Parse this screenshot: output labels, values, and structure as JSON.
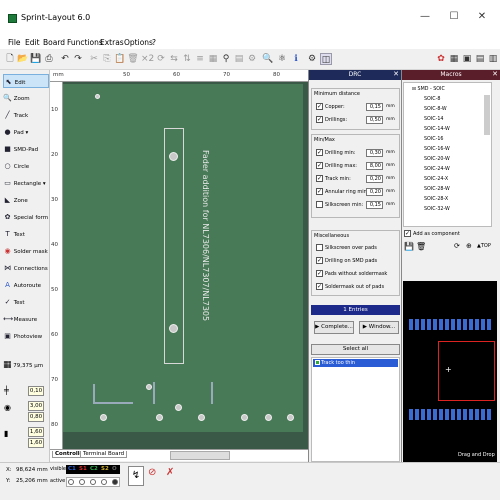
{
  "window": {
    "title": "Sprint-Layout 6.0",
    "minimize": "—",
    "maximize": "☐",
    "close": "✕"
  },
  "menu": [
    "File",
    "Edit",
    "Board",
    "Functions",
    "Extras",
    "Options",
    "?"
  ],
  "tools": [
    {
      "label": "Edit",
      "icon": "⬉"
    },
    {
      "label": "Zoom",
      "icon": "🔍"
    },
    {
      "label": "Track",
      "icon": "╱"
    },
    {
      "label": "Pad",
      "icon": "●"
    },
    {
      "label": "SMD-Pad",
      "icon": "■"
    },
    {
      "label": "Circle",
      "icon": "○"
    },
    {
      "label": "Rectangle",
      "icon": "▭"
    },
    {
      "label": "Zone",
      "icon": "◣"
    },
    {
      "label": "Special form",
      "icon": "✿"
    },
    {
      "label": "Text",
      "icon": "T"
    },
    {
      "label": "Solder mask",
      "icon": "◉"
    },
    {
      "label": "Connections",
      "icon": "⋈"
    },
    {
      "label": "Autoroute",
      "icon": "A"
    },
    {
      "label": "Test",
      "icon": "✓"
    },
    {
      "label": "Measure",
      "icon": "⟷"
    },
    {
      "label": "Photoview",
      "icon": "▣"
    }
  ],
  "grid": {
    "value": "79,375 µm"
  },
  "spinners": [
    "0,10",
    "3,00",
    "0,80",
    "1,60",
    "1,60"
  ],
  "ruler": {
    "unit": "mm",
    "ticks": [
      "50",
      "60",
      "70",
      "80"
    ],
    "left_ticks": [
      "10",
      "20",
      "30",
      "40",
      "50",
      "60",
      "70",
      "80"
    ]
  },
  "board": {
    "silkscreen_text": "Fader addition for NL7306/NL7307/NL7305"
  },
  "tabs": [
    "Controller",
    "Terminal Board"
  ],
  "status": {
    "x_label": "X:",
    "x_value": "98,624 mm",
    "y_label": "Y:",
    "y_value": "25,206 mm",
    "visible_label": "visible",
    "active_label": "active",
    "layers": [
      "C1",
      "S1",
      "C2",
      "S2",
      "O"
    ],
    "layer_colors": [
      "#2d5fd1",
      "#d92b2b",
      "#2fa84a",
      "#d1b22d",
      "#666666"
    ]
  },
  "drc": {
    "title": "DRC",
    "min_distance": {
      "title": "Minimum distance",
      "copper_label": "Copper:",
      "copper_value": "0,15",
      "drillings_label": "Drillings:",
      "drillings_value": "0,50",
      "unit": "mm"
    },
    "minmax": {
      "title": "Min/Max",
      "rows": [
        {
          "label": "Drilling min:",
          "value": "0,30",
          "checked": true
        },
        {
          "label": "Drilling max:",
          "value": "8,00",
          "checked": true
        },
        {
          "label": "Track min:",
          "value": "0,20",
          "checked": true
        },
        {
          "label": "Annular ring min:",
          "value": "0,20",
          "checked": true
        },
        {
          "label": "Silkscreen min:",
          "value": "0,15",
          "checked": false
        }
      ]
    },
    "misc": {
      "title": "Miscellaneous",
      "rows": [
        {
          "label": "Silkscreen over pads",
          "checked": false
        },
        {
          "label": "Drilling on SMD pads",
          "checked": true
        },
        {
          "label": "Pads without soldermask",
          "checked": true
        },
        {
          "label": "Soldermask out of pads",
          "checked": true
        }
      ]
    },
    "entries": "1 Entries",
    "complete_button": "Complete...",
    "window_button": "Window...",
    "select_all": "Select all",
    "result": "Track too thin"
  },
  "macros": {
    "title": "Macros",
    "root": "SMD - SOIC",
    "items": [
      "SOIC-8",
      "SOIC-8-W",
      "SOIC-14",
      "SOIC-14-W",
      "SOIC-16",
      "SOIC-16-W",
      "SOIC-20-W",
      "SOIC-24-W",
      "SOIC-24-X",
      "SOIC-28-W",
      "SOIC-28-X",
      "SOIC-32-W"
    ],
    "add_component": "Add as component",
    "drag_drop": "Drag and Drop"
  }
}
